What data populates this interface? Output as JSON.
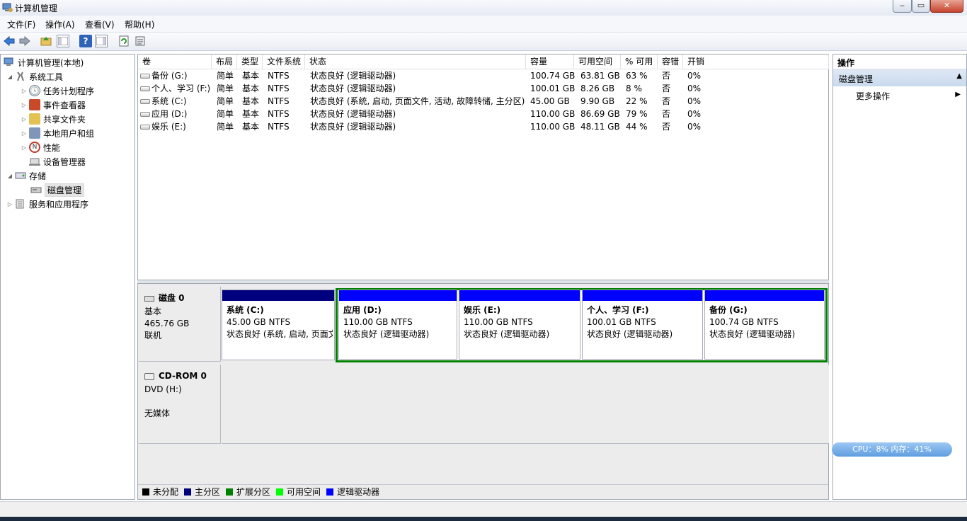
{
  "window": {
    "title": "计算机管理",
    "minimize": "‒",
    "maximize": "▭",
    "close": "✕"
  },
  "menu": [
    "文件(F)",
    "操作(A)",
    "查看(V)",
    "帮助(H)"
  ],
  "toolbar": [
    "back-icon",
    "forward-icon",
    "up-icon",
    "show-hide-tree-icon",
    "help-icon",
    "properties-icon",
    "refresh-icon",
    "export-icon"
  ],
  "tree": {
    "root": "计算机管理(本地)",
    "system_tools": "系统工具",
    "task_scheduler": "任务计划程序",
    "event_viewer": "事件查看器",
    "shared_folders": "共享文件夹",
    "local_users": "本地用户和组",
    "performance": "性能",
    "device_manager": "设备管理器",
    "storage": "存储",
    "disk_management": "磁盘管理",
    "services": "服务和应用程序"
  },
  "columns": [
    "卷",
    "布局",
    "类型",
    "文件系统",
    "状态",
    "容量",
    "可用空间",
    "% 可用",
    "容错",
    "开销"
  ],
  "volumes": [
    {
      "name": "备份 (G:)",
      "layout": "简单",
      "type": "基本",
      "fs": "NTFS",
      "status": "状态良好 (逻辑驱动器)",
      "capacity": "100.74 GB",
      "free": "63.81 GB",
      "pct": "63 %",
      "fault": "否",
      "overhead": "0%"
    },
    {
      "name": "个人、学习 (F:)",
      "layout": "简单",
      "type": "基本",
      "fs": "NTFS",
      "status": "状态良好 (逻辑驱动器)",
      "capacity": "100.01 GB",
      "free": "8.26 GB",
      "pct": "8 %",
      "fault": "否",
      "overhead": "0%"
    },
    {
      "name": "系统 (C:)",
      "layout": "简单",
      "type": "基本",
      "fs": "NTFS",
      "status": "状态良好 (系统, 启动, 页面文件, 活动, 故障转储, 主分区)",
      "capacity": "45.00 GB",
      "free": "9.90 GB",
      "pct": "22 %",
      "fault": "否",
      "overhead": "0%"
    },
    {
      "name": "应用 (D:)",
      "layout": "简单",
      "type": "基本",
      "fs": "NTFS",
      "status": "状态良好 (逻辑驱动器)",
      "capacity": "110.00 GB",
      "free": "86.69 GB",
      "pct": "79 %",
      "fault": "否",
      "overhead": "0%"
    },
    {
      "name": "娱乐 (E:)",
      "layout": "简单",
      "type": "基本",
      "fs": "NTFS",
      "status": "状态良好 (逻辑驱动器)",
      "capacity": "110.00 GB",
      "free": "48.11 GB",
      "pct": "44 %",
      "fault": "否",
      "overhead": "0%"
    }
  ],
  "disk0": {
    "title": "磁盘 0",
    "kind": "基本",
    "size": "465.76 GB",
    "state": "联机"
  },
  "cdrom": {
    "title": "CD-ROM 0",
    "kind": "DVD (H:)",
    "state": "无媒体"
  },
  "partitions": [
    {
      "name": "系统  (C:)",
      "size": "45.00 GB NTFS",
      "status": "状态良好 (系统, 启动, 页面文件, 活动, 故障转储, 主分区)",
      "color": "#00007f"
    },
    {
      "name": "应用  (D:)",
      "size": "110.00 GB NTFS",
      "status": "状态良好 (逻辑驱动器)",
      "color": "#0000ff"
    },
    {
      "name": "娱乐  (E:)",
      "size": "110.00 GB NTFS",
      "status": "状态良好 (逻辑驱动器)",
      "color": "#0000ff"
    },
    {
      "name": "个人、学习  (F:)",
      "size": "100.01 GB NTFS",
      "status": "状态良好 (逻辑驱动器)",
      "color": "#0000ff"
    },
    {
      "name": "备份  (G:)",
      "size": "100.74 GB NTFS",
      "status": "状态良好 (逻辑驱动器)",
      "color": "#0000ff"
    }
  ],
  "legend": [
    {
      "label": "未分配",
      "color": "#000000"
    },
    {
      "label": "主分区",
      "color": "#00007f"
    },
    {
      "label": "扩展分区",
      "color": "#008000"
    },
    {
      "label": "可用空间",
      "color": "#00ff00"
    },
    {
      "label": "逻辑驱动器",
      "color": "#0000ff"
    }
  ],
  "actions": {
    "header": "操作",
    "section": "磁盘管理",
    "more": "更多操作"
  },
  "cpu_widget": "CPU：8%   内存：41%"
}
